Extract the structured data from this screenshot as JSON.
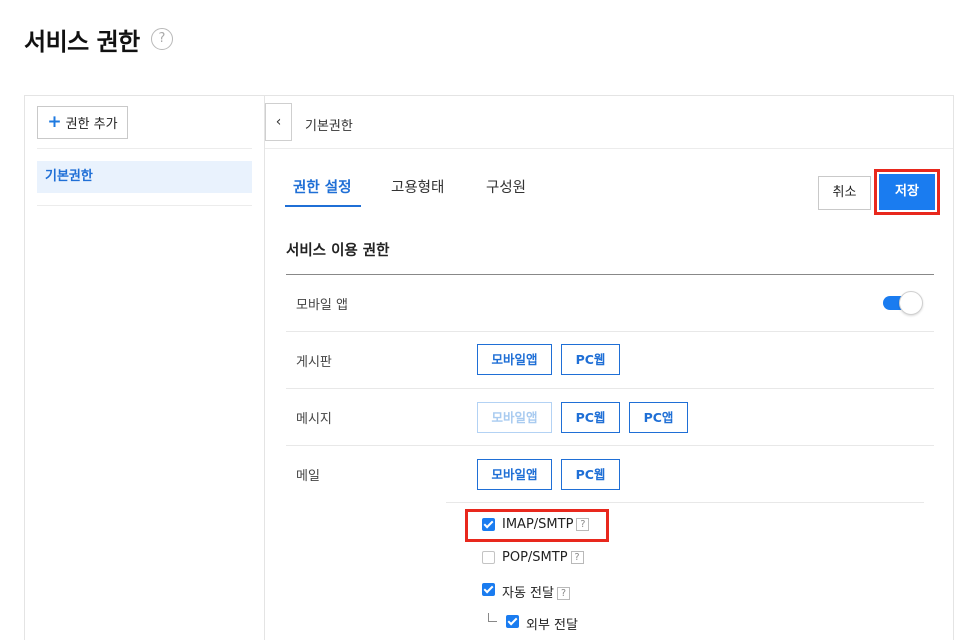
{
  "page": {
    "title": "서비스 권한",
    "help_glyph": "?"
  },
  "sidebar": {
    "add_button": {
      "icon": "plus-icon",
      "label": "권한 추가"
    },
    "items": [
      {
        "label": "기본권한",
        "selected": true
      }
    ]
  },
  "detail": {
    "collapse_icon": "chevron-left-icon",
    "breadcrumb": "기본권한",
    "tabs": [
      {
        "label": "권한 설정",
        "active": true
      },
      {
        "label": "고용형태",
        "active": false
      },
      {
        "label": "구성원",
        "active": false
      }
    ],
    "actions": {
      "cancel": "취소",
      "save": "저장"
    },
    "section_title": "서비스 이용 권한",
    "rows": {
      "mobile_app": {
        "label": "모바일 앱",
        "toggle_on": true
      },
      "board": {
        "label": "게시판",
        "chips": [
          {
            "label": "모바일앱",
            "enabled": true
          },
          {
            "label": "PC웹",
            "enabled": true
          }
        ]
      },
      "messenger": {
        "label": "메시지",
        "chips": [
          {
            "label": "모바일앱",
            "enabled": false
          },
          {
            "label": "PC웹",
            "enabled": true
          },
          {
            "label": "PC앱",
            "enabled": true
          }
        ]
      },
      "mail": {
        "label": "메일",
        "chips": [
          {
            "label": "모바일앱",
            "enabled": true
          },
          {
            "label": "PC웹",
            "enabled": true
          }
        ],
        "options": [
          {
            "label": "IMAP/SMTP",
            "checked": true,
            "help": "?"
          },
          {
            "label": "POP/SMTP",
            "checked": false,
            "help": "?"
          },
          {
            "label": "자동 전달",
            "checked": true,
            "help": "?"
          },
          {
            "label": "외부 전달",
            "checked": true
          }
        ]
      }
    }
  },
  "colors": {
    "accent": "#1a7cf0",
    "highlight": "#e8281d",
    "selected_bg": "#e9f2fd"
  }
}
